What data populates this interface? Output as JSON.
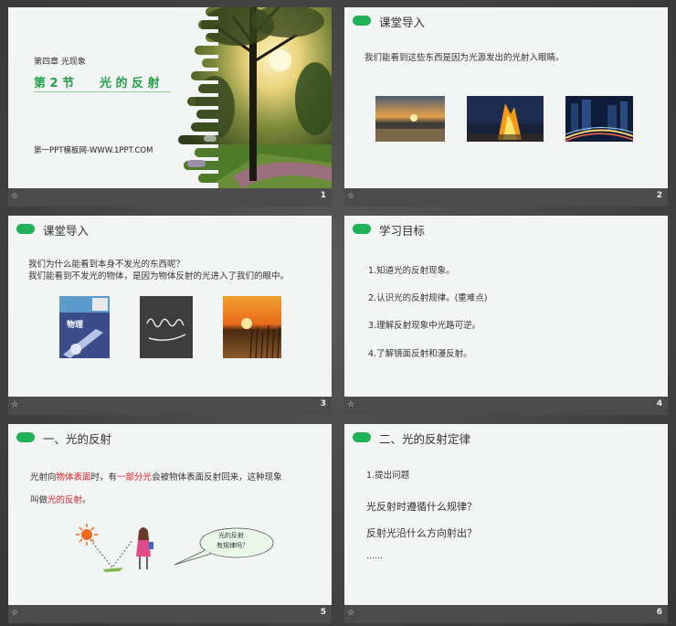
{
  "slides": [
    {
      "number": "1",
      "chapter": "第四章 光现象",
      "section": "第 2 节",
      "title": "光 的 反 射",
      "site": "第一PPT模板网-WWW.1PPT.COM"
    },
    {
      "number": "2",
      "heading": "课堂导入",
      "body": "我们能看到这些东西是因为光源发出的光射入眼睛。"
    },
    {
      "number": "3",
      "heading": "课堂导入",
      "line1": "我们为什么能看到本身不发光的东西呢？",
      "line2": "我们能看到不发光的物体，是因为物体反射的光进入了我们的眼中。",
      "book_label": "物理"
    },
    {
      "number": "4",
      "heading": "学习目标",
      "items": [
        "1.知道光的反射现象。",
        "2.认识光的反射规律。(重难点)",
        "3.理解反射现象中光路可逆。",
        "4.了解镜面反射和漫反射。"
      ]
    },
    {
      "number": "5",
      "heading": "一、光的反射",
      "p1": "光射向",
      "p2": "物体表面",
      "p3": "时，有",
      "p4": "一部分光",
      "p5": "会被物体表面反射回来，这种现象",
      "p6": "叫做",
      "p7": "光的反射",
      "p8": "。",
      "bubble1": "光的反射",
      "bubble2": "有规律吗？"
    },
    {
      "number": "6",
      "heading": "二、光的反射定律",
      "sub": "1.提出问题",
      "q1": "光反射时遵循什么规律？",
      "q2": "反射光沿什么方向射出？",
      "ellipsis": "……"
    }
  ],
  "colors": {
    "accent_green": "#1fb257",
    "highlight_red": "#e02020",
    "title_green": "#21a04a"
  }
}
